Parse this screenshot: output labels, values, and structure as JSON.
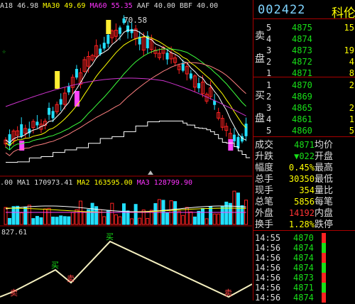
{
  "legend_main": [
    {
      "text": "A18 46.98",
      "color": "#ddd"
    },
    {
      "text": "MA30 49.69",
      "color": "#ff0"
    },
    {
      "text": "MA60 55.35",
      "color": "#ff33ff"
    },
    {
      "text": "AAF 40.00",
      "color": "#ddd"
    },
    {
      "text": "BBF 40.00",
      "color": "#ddd"
    }
  ],
  "peak_label": "70.58",
  "legend_vol": [
    {
      "text": ".00",
      "color": "#ddd"
    },
    {
      "text": "MA1 170973.41",
      "color": "#ddd"
    },
    {
      "text": "MA2 163595.00",
      "color": "#ff0"
    },
    {
      "text": "MA3 128799.90",
      "color": "#ff33ff"
    }
  ],
  "legend_ind": "827.61",
  "signals": {
    "buy": "买",
    "sell": "卖"
  },
  "panel": {
    "code": "002422",
    "name": "科伦",
    "sell_label_1": "卖",
    "sell_label_2": "盘",
    "buy_label_1": "买",
    "buy_label_2": "盘",
    "asks": [
      {
        "lvl": "5",
        "price": "4875",
        "vol": "15"
      },
      {
        "lvl": "4",
        "price": "4874",
        "vol": ""
      },
      {
        "lvl": "3",
        "price": "4873",
        "vol": "19"
      },
      {
        "lvl": "2",
        "price": "4872",
        "vol": "4"
      },
      {
        "lvl": "1",
        "price": "4871",
        "vol": "8"
      }
    ],
    "bids": [
      {
        "lvl": "1",
        "price": "4870",
        "vol": "2"
      },
      {
        "lvl": "2",
        "price": "4869",
        "vol": ""
      },
      {
        "lvl": "3",
        "price": "4865",
        "vol": "2"
      },
      {
        "lvl": "4",
        "price": "4861",
        "vol": "1"
      },
      {
        "lvl": "5",
        "price": "4860",
        "vol": "5"
      }
    ],
    "stats": [
      {
        "k": "成交",
        "v": "4871",
        "vc": "#18e018",
        "k2": "均价"
      },
      {
        "k": "升跌",
        "v": "▼022",
        "vc": "#18e018",
        "k2": "开盘"
      },
      {
        "k": "幅度",
        "v": "0.45%",
        "vc": "#ff0",
        "k2": "最高"
      },
      {
        "k": "总手",
        "v": "30350",
        "vc": "#ff0",
        "k2": "最低"
      },
      {
        "k": "现手",
        "v": "354",
        "vc": "#ff0",
        "k2": "量比"
      },
      {
        "k": "总笔",
        "v": "5856",
        "vc": "#ff0",
        "k2": "每笔"
      },
      {
        "k": "外盘",
        "v": "14192",
        "vc": "#ff3333",
        "k2": "内盘"
      },
      {
        "k": "换手",
        "v": "1.28%",
        "vc": "#ff0",
        "k2": "跌停"
      }
    ],
    "ticks": [
      {
        "t": "14:55",
        "p": "4870"
      },
      {
        "t": "14:56",
        "p": "4874"
      },
      {
        "t": "14:56",
        "p": "4874"
      },
      {
        "t": "14:56",
        "p": "4874"
      },
      {
        "t": "14:56",
        "p": "4873"
      },
      {
        "t": "14:56",
        "p": "4871"
      },
      {
        "t": "14:56",
        "p": "4874"
      }
    ]
  },
  "colors": {
    "up": "#ff2222",
    "down": "#22e0ff",
    "grid": "#a00000",
    "zigzag": "#f5f0c0"
  }
}
